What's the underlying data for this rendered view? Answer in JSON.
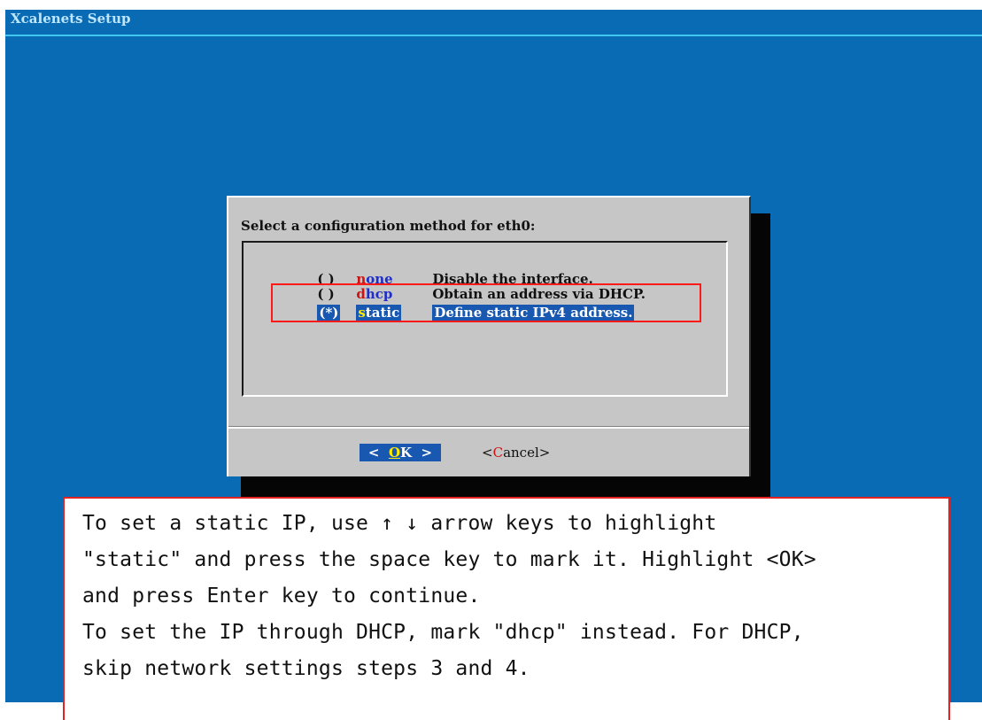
{
  "window": {
    "title": "Xcalenets Setup"
  },
  "dialog": {
    "prompt": "Select a configuration method for eth0:",
    "options": [
      {
        "radio": "( )",
        "tag_hotkey": "n",
        "tag_rest": "one",
        "description": "Disable the interface.",
        "selected": false
      },
      {
        "radio": "( )",
        "tag_hotkey": "d",
        "tag_rest": "hcp",
        "description": "Obtain an address via DHCP.",
        "selected": false
      },
      {
        "radio": "(*)",
        "tag_hotkey": "s",
        "tag_rest": "tatic",
        "description": "Define static IPv4 address.",
        "selected": true
      }
    ],
    "buttons": {
      "ok": {
        "left": "<  ",
        "hotkey": "O",
        "rest": "K",
        "right": "  >"
      },
      "cancel": {
        "left": "<",
        "hotkey": "C",
        "rest": "ancel",
        "right": ">"
      }
    }
  },
  "callout": {
    "lines": [
      "To set a static IP, use ↑ ↓ arrow keys to highlight",
      "\"static\" and press the space key to mark it. Highlight <OK>",
      "and press Enter key to continue.",
      "To set the IP through DHCP, mark \"dhcp\" instead. For DHCP,",
      "skip network settings steps 3 and 4."
    ]
  },
  "colors": {
    "screen_bg": "#0a6bb5",
    "dialog_bg": "#c6c6c6",
    "selection_bg": "#1958b0",
    "hotkey_red": "#d01212",
    "hotkey_yellow": "#ffea00",
    "annotation_red": "#ff1a1a"
  }
}
